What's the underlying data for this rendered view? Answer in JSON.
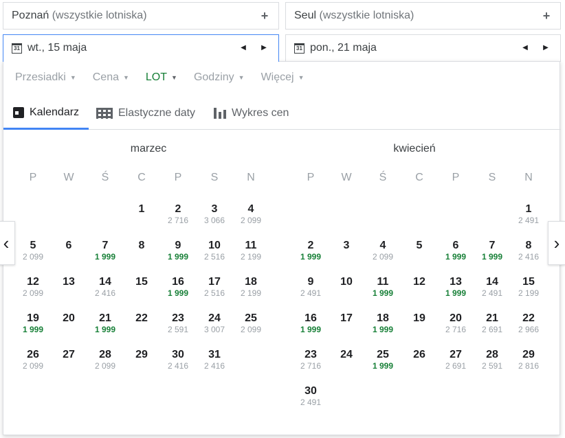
{
  "origin": {
    "place": "Poznań",
    "qualifier": "(wszystkie lotniska)"
  },
  "destination": {
    "place": "Seul",
    "qualifier": "(wszystkie lotniska)"
  },
  "plus_icon": "+",
  "calendar_icon_text": "31",
  "depart_date": "wt., 15 maja",
  "return_date": "pon., 21 maja",
  "filters": [
    {
      "label": "Przesiadki",
      "active": false
    },
    {
      "label": "Cena",
      "active": false
    },
    {
      "label": "LOT",
      "active": true
    },
    {
      "label": "Godziny",
      "active": false
    },
    {
      "label": "Więcej",
      "active": false
    }
  ],
  "tabs": {
    "calendar": "Kalendarz",
    "flexible": "Elastyczne daty",
    "chart": "Wykres cen"
  },
  "weekdays": [
    "P",
    "W",
    "Ś",
    "C",
    "P",
    "S",
    "N"
  ],
  "colors": {
    "accent": "#4285f4",
    "low_price": "#188038",
    "muted": "#9aa0a6"
  },
  "months": [
    {
      "name": "marzec",
      "first_col": 3,
      "days": [
        {
          "d": "1",
          "p": ""
        },
        {
          "d": "2",
          "p": "2 716"
        },
        {
          "d": "3",
          "p": "3 066"
        },
        {
          "d": "4",
          "p": "2 099"
        },
        {
          "d": "5",
          "p": "2 099"
        },
        {
          "d": "6",
          "p": ""
        },
        {
          "d": "7",
          "p": "1 999",
          "low": true
        },
        {
          "d": "8",
          "p": ""
        },
        {
          "d": "9",
          "p": "1 999",
          "low": true
        },
        {
          "d": "10",
          "p": "2 516"
        },
        {
          "d": "11",
          "p": "2 199"
        },
        {
          "d": "12",
          "p": "2 099"
        },
        {
          "d": "13",
          "p": ""
        },
        {
          "d": "14",
          "p": "2 416"
        },
        {
          "d": "15",
          "p": ""
        },
        {
          "d": "16",
          "p": "1 999",
          "low": true
        },
        {
          "d": "17",
          "p": "2 516"
        },
        {
          "d": "18",
          "p": "2 199"
        },
        {
          "d": "19",
          "p": "1 999",
          "low": true
        },
        {
          "d": "20",
          "p": ""
        },
        {
          "d": "21",
          "p": "1 999",
          "low": true
        },
        {
          "d": "22",
          "p": ""
        },
        {
          "d": "23",
          "p": "2 591"
        },
        {
          "d": "24",
          "p": "3 007"
        },
        {
          "d": "25",
          "p": "2 099"
        },
        {
          "d": "26",
          "p": "2 099"
        },
        {
          "d": "27",
          "p": ""
        },
        {
          "d": "28",
          "p": "2 099"
        },
        {
          "d": "29",
          "p": ""
        },
        {
          "d": "30",
          "p": "2 416"
        },
        {
          "d": "31",
          "p": "2 416"
        }
      ]
    },
    {
      "name": "kwiecień",
      "first_col": 6,
      "days": [
        {
          "d": "1",
          "p": "2 491"
        },
        {
          "d": "2",
          "p": "1 999",
          "low": true
        },
        {
          "d": "3",
          "p": ""
        },
        {
          "d": "4",
          "p": "2 099"
        },
        {
          "d": "5",
          "p": ""
        },
        {
          "d": "6",
          "p": "1 999",
          "low": true
        },
        {
          "d": "7",
          "p": "1 999",
          "low": true
        },
        {
          "d": "8",
          "p": "2 416"
        },
        {
          "d": "9",
          "p": "2 491"
        },
        {
          "d": "10",
          "p": ""
        },
        {
          "d": "11",
          "p": "1 999",
          "low": true
        },
        {
          "d": "12",
          "p": ""
        },
        {
          "d": "13",
          "p": "1 999",
          "low": true
        },
        {
          "d": "14",
          "p": "2 491"
        },
        {
          "d": "15",
          "p": "2 199"
        },
        {
          "d": "16",
          "p": "1 999",
          "low": true
        },
        {
          "d": "17",
          "p": ""
        },
        {
          "d": "18",
          "p": "1 999",
          "low": true
        },
        {
          "d": "19",
          "p": ""
        },
        {
          "d": "20",
          "p": "2 716"
        },
        {
          "d": "21",
          "p": "2 691"
        },
        {
          "d": "22",
          "p": "2 966"
        },
        {
          "d": "23",
          "p": "2 716"
        },
        {
          "d": "24",
          "p": ""
        },
        {
          "d": "25",
          "p": "1 999",
          "low": true
        },
        {
          "d": "26",
          "p": ""
        },
        {
          "d": "27",
          "p": "2 691"
        },
        {
          "d": "28",
          "p": "2 591"
        },
        {
          "d": "29",
          "p": "2 816"
        },
        {
          "d": "30",
          "p": "2 491"
        }
      ]
    }
  ]
}
